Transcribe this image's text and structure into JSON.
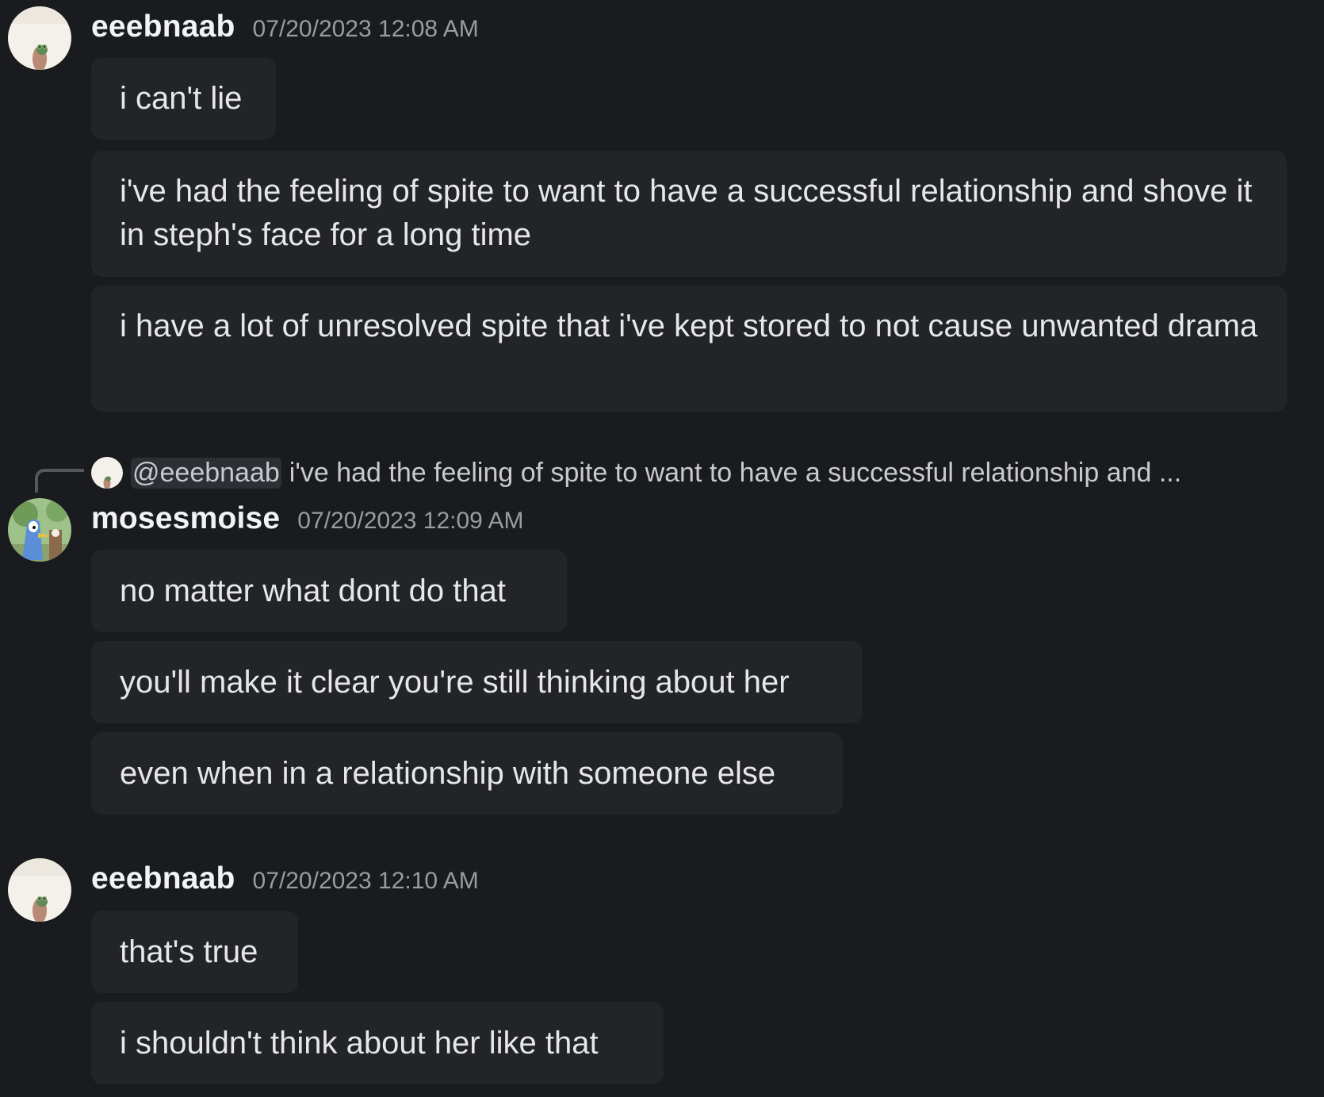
{
  "messages": [
    {
      "username": "eeebnaab",
      "timestamp": "07/20/2023 12:08 AM",
      "avatar_icon": "frog-photo-avatar",
      "lines": [
        "i can't lie",
        "i've had the feeling of spite to want to have a successful relationship and shove it in steph's face for a long time",
        "i have a lot of unresolved spite that i've kept stored to not cause unwanted drama"
      ]
    },
    {
      "reply": {
        "mention": "@eeebnaab",
        "text": "i've had the feeling of spite to want to have a successful relationship and ..."
      },
      "username": "mosesmoise",
      "timestamp": "07/20/2023 12:09 AM",
      "avatar_icon": "cartoon-bird-avatar",
      "lines": [
        "no matter what dont do that",
        "you'll make it clear you're still thinking about her",
        "even when in a relationship with someone else"
      ]
    },
    {
      "username": "eeebnaab",
      "timestamp": "07/20/2023 12:10 AM",
      "avatar_icon": "frog-photo-avatar",
      "lines": [
        "that's true",
        "i shouldn't think about her like that"
      ]
    }
  ],
  "colors": {
    "background": "#1a1b1e",
    "bubble": "#232428",
    "username": "#f2f3f5",
    "timestamp": "#9a9ca3"
  }
}
